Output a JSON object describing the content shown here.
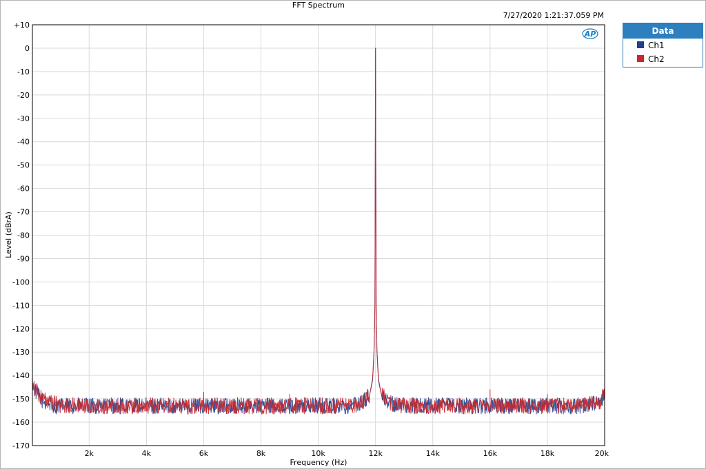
{
  "timestamp": "7/27/2020 1:21:37.059 PM",
  "logo": {
    "text": "AP",
    "color": "#1a7fc1"
  },
  "legend": {
    "title": "Data",
    "items": [
      {
        "label": "Ch1",
        "color": "#1f3f8f"
      },
      {
        "label": "Ch2",
        "color": "#c8282d"
      }
    ]
  },
  "colors": {
    "grid": "#d9d9d9",
    "axis": "#000000",
    "legend_header": "#2e7fbd"
  },
  "chart_data": {
    "type": "line",
    "title": "FFT Spectrum",
    "xlabel": "Frequency (Hz)",
    "ylabel": "Level (dBrA)",
    "xlim": [
      20,
      20000
    ],
    "ylim": [
      -170,
      10
    ],
    "x_ticks": [
      {
        "value": 2000,
        "label": "2k"
      },
      {
        "value": 4000,
        "label": "4k"
      },
      {
        "value": 6000,
        "label": "6k"
      },
      {
        "value": 8000,
        "label": "8k"
      },
      {
        "value": 10000,
        "label": "10k"
      },
      {
        "value": 12000,
        "label": "12k"
      },
      {
        "value": 14000,
        "label": "14k"
      },
      {
        "value": 16000,
        "label": "16k"
      },
      {
        "value": 18000,
        "label": "18k"
      },
      {
        "value": 20000,
        "label": "20k"
      }
    ],
    "y_ticks": [
      {
        "value": 10,
        "label": "+10"
      },
      {
        "value": 0,
        "label": "0"
      },
      {
        "value": -10,
        "label": "-10"
      },
      {
        "value": -20,
        "label": "-20"
      },
      {
        "value": -30,
        "label": "-30"
      },
      {
        "value": -40,
        "label": "-40"
      },
      {
        "value": -50,
        "label": "-50"
      },
      {
        "value": -60,
        "label": "-60"
      },
      {
        "value": -70,
        "label": "-70"
      },
      {
        "value": -80,
        "label": "-80"
      },
      {
        "value": -90,
        "label": "-90"
      },
      {
        "value": -100,
        "label": "-100"
      },
      {
        "value": -110,
        "label": "-110"
      },
      {
        "value": -120,
        "label": "-120"
      },
      {
        "value": -130,
        "label": "-130"
      },
      {
        "value": -140,
        "label": "-140"
      },
      {
        "value": -150,
        "label": "-150"
      },
      {
        "value": -160,
        "label": "-160"
      },
      {
        "value": -170,
        "label": "-170"
      }
    ],
    "grid": true,
    "legend_position": "right",
    "series": [
      {
        "name": "Ch1",
        "x": [
          20,
          100,
          200,
          300,
          400,
          500,
          600,
          800,
          1000,
          1500,
          2000,
          3000,
          4000,
          5000,
          6000,
          7000,
          8000,
          9000,
          10000,
          11000,
          11500,
          11800,
          11900,
          11950,
          11980,
          12000,
          12020,
          12050,
          12100,
          12200,
          12500,
          13000,
          14000,
          15000,
          16000,
          17000,
          18000,
          19000,
          19800,
          20000
        ],
        "y": [
          -143,
          -146,
          -148,
          -150,
          -151,
          -152,
          -152,
          -153,
          -153,
          -153,
          -153,
          -153,
          -153,
          -153,
          -153,
          -153,
          -153,
          -153,
          -153,
          -153,
          -152,
          -148,
          -142,
          -130,
          -110,
          0,
          -110,
          -130,
          -142,
          -148,
          -152,
          -153,
          -153,
          -153,
          -153,
          -153,
          -153,
          -153,
          -152,
          -148
        ]
      },
      {
        "name": "Ch2",
        "x": [
          20,
          100,
          200,
          300,
          400,
          500,
          600,
          800,
          1000,
          1500,
          2000,
          3000,
          4000,
          5000,
          6000,
          7000,
          8000,
          9000,
          10000,
          11000,
          11500,
          11800,
          11900,
          11950,
          11980,
          12000,
          12020,
          12050,
          12100,
          12200,
          12500,
          13000,
          14000,
          15000,
          16000,
          17000,
          18000,
          19000,
          19800,
          20000
        ],
        "y": [
          -142,
          -145,
          -147,
          -149,
          -150,
          -151,
          -152,
          -152,
          -153,
          -153,
          -153,
          -153,
          -153,
          -153,
          -153,
          -153,
          -153,
          -153,
          -153,
          -153,
          -152,
          -148,
          -141,
          -129,
          -109,
          0,
          -109,
          -129,
          -141,
          -148,
          -152,
          -153,
          -153,
          -153,
          -153,
          -153,
          -153,
          -153,
          -152,
          -147
        ]
      }
    ],
    "annotations": [
      {
        "x": 6000,
        "y": -147,
        "series": "Ch2"
      },
      {
        "x": 9000,
        "y": -148,
        "series": "Ch2"
      },
      {
        "x": 16000,
        "y": -146,
        "series": "Ch2"
      },
      {
        "x": 18000,
        "y": -148,
        "series": "Ch2"
      }
    ]
  }
}
